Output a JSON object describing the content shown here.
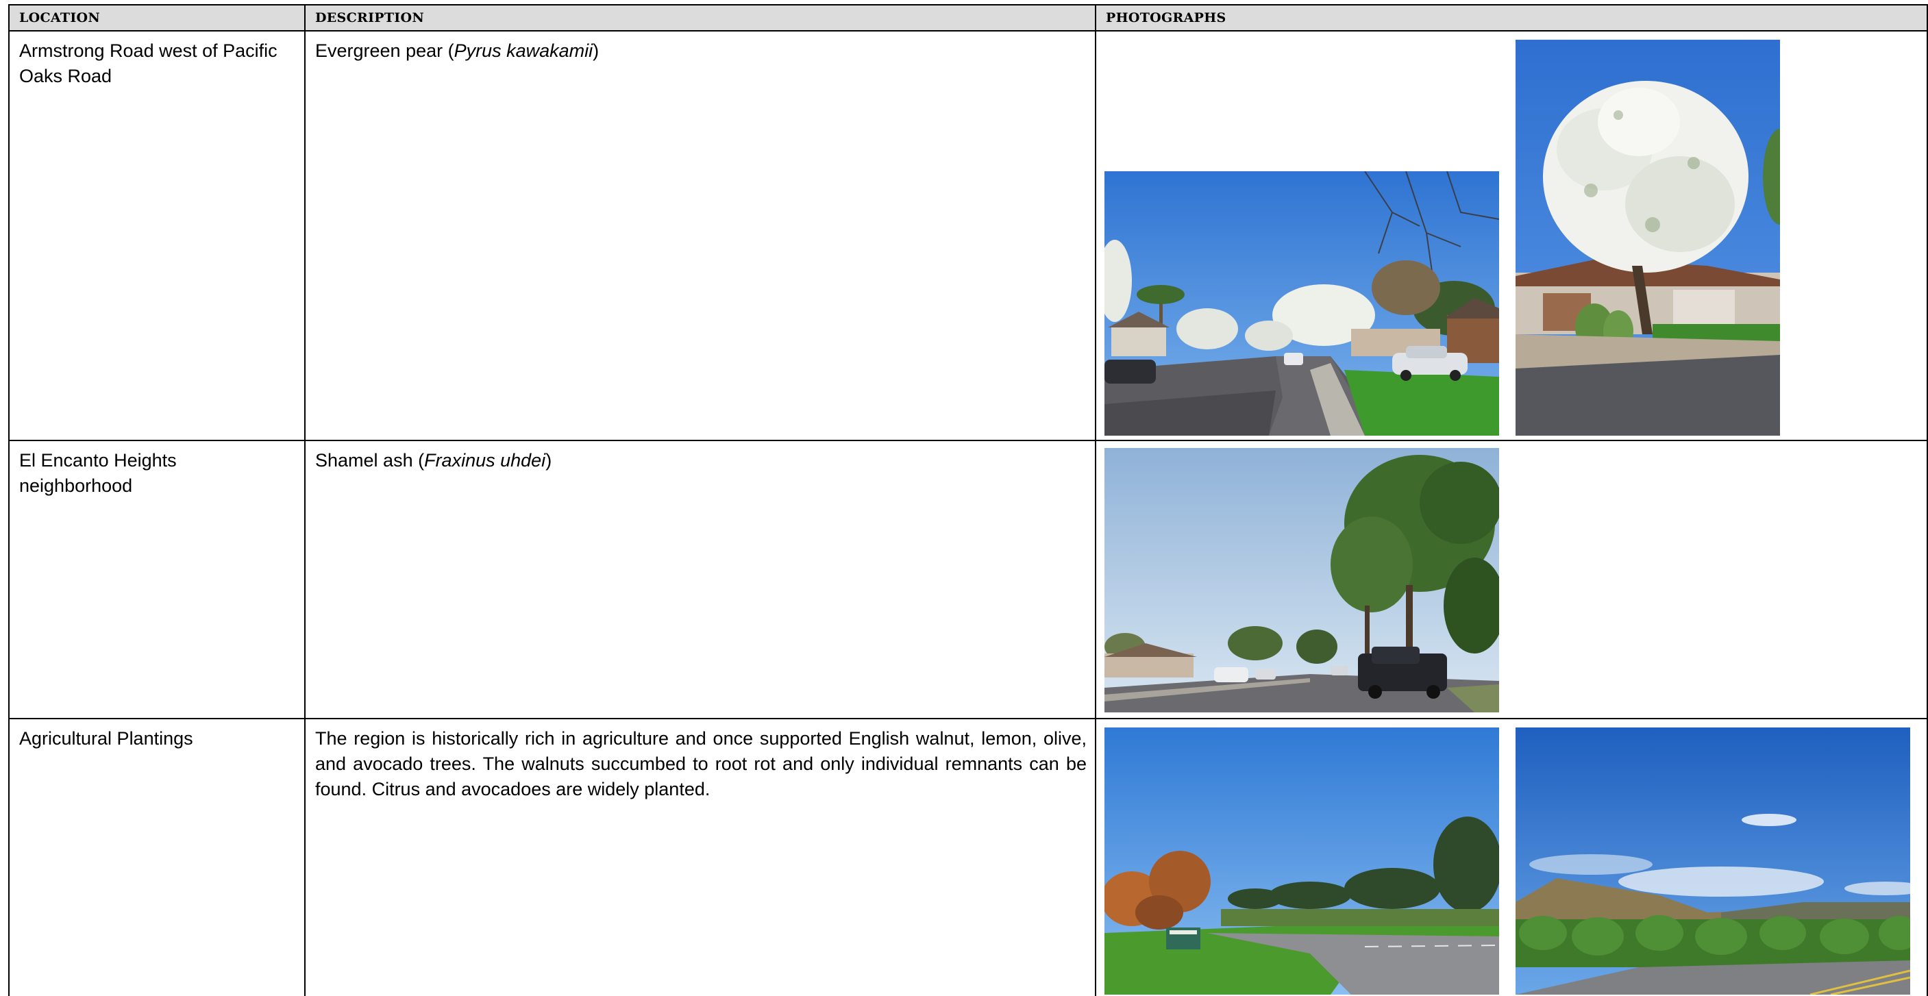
{
  "table": {
    "headers": {
      "location": "LOCATION",
      "description": "DESCRIPTION",
      "photographs": "PHOTOGRAPHS"
    },
    "rows": [
      {
        "location": "Armstrong Road west of Pacific Oaks Road",
        "description_prefix": "Evergreen pear (",
        "description_italic": "Pyrus kawakamii",
        "description_suffix": ")",
        "photos": [
          "street-with-flowering-pear-trees-photo",
          "flowering-pear-tree-photo"
        ]
      },
      {
        "location": "El Encanto Heights neighborhood",
        "description_prefix": "Shamel ash (",
        "description_italic": "Fraxinus uhdei",
        "description_suffix": ")",
        "photos": [
          "street-with-ash-trees-photo"
        ]
      },
      {
        "location": "Agricultural Plantings",
        "description": "The region is historically rich in agriculture and once supported English walnut, lemon, olive, and avocado trees. The walnuts succumbed to root rot and only individual remnants can be found. Citrus and avocadoes are widely planted.",
        "photos": [
          "roadside-orchard-photo",
          "hillside-citrus-orchard-photo"
        ]
      }
    ]
  },
  "colors": {
    "header_background": "#dcdcdc",
    "border": "#000000",
    "sky": "#3f86d8"
  }
}
